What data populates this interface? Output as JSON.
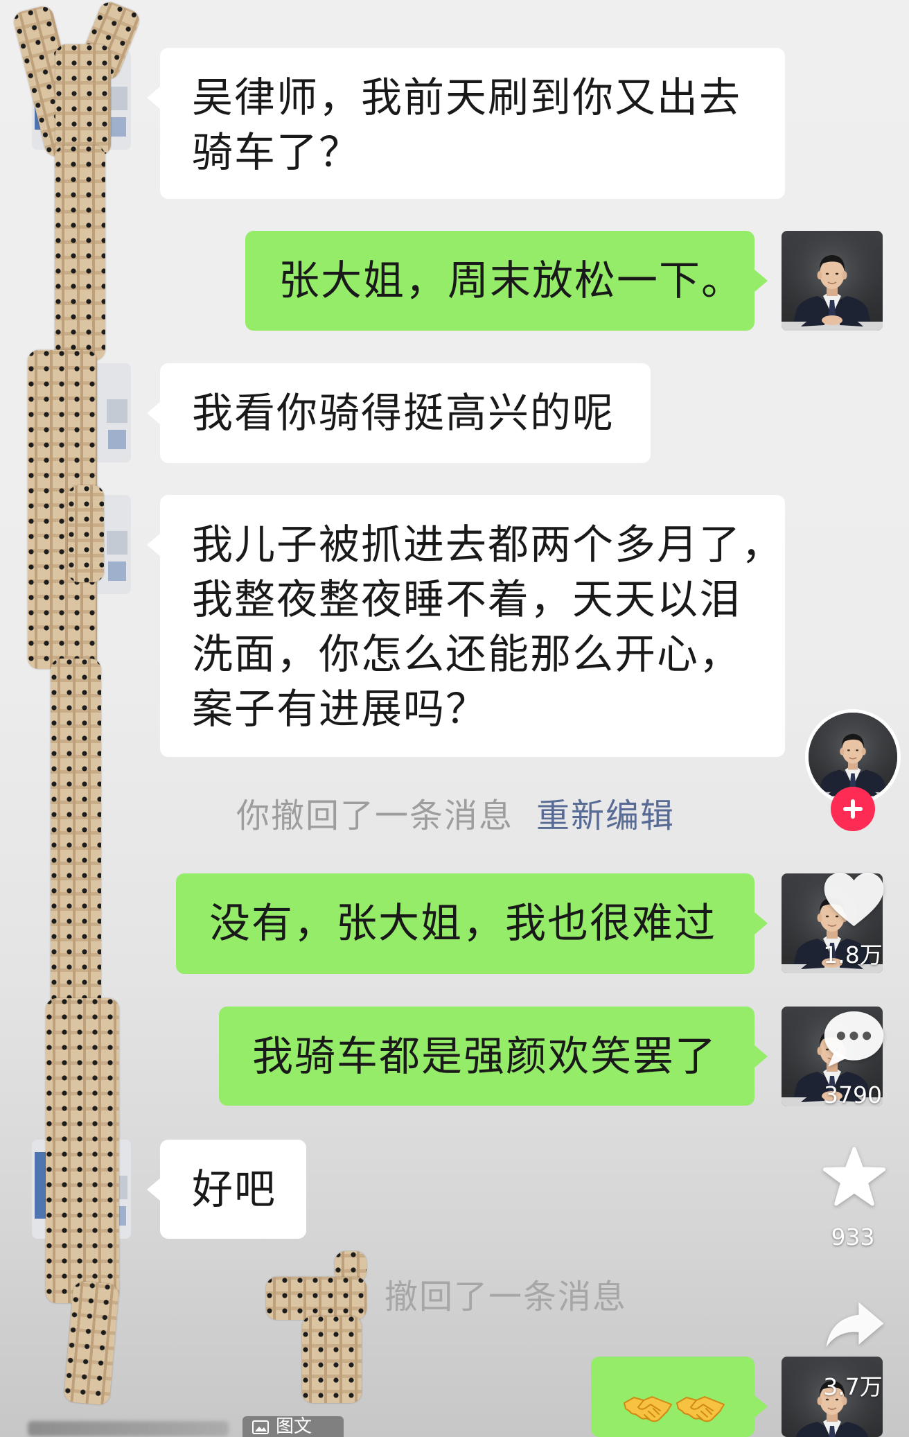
{
  "colors": {
    "outgoing_bubble": "#95ec69",
    "incoming_bubble": "#ffffff",
    "recall_link": "#576b95",
    "follow_badge": "#fe2c55"
  },
  "chat": {
    "messages": [
      {
        "lines": [
          "吴律师，我前天刷到你又出去",
          "骑车了？"
        ]
      },
      {
        "lines": [
          "张大姐，周末放松一下。"
        ]
      },
      {
        "lines": [
          "我看你骑得挺高兴的呢"
        ]
      },
      {
        "lines": [
          "我儿子被抓进去都两个多月了，",
          "我整夜整夜睡不着，天天以泪",
          "洗面，你怎么还能那么开心，",
          "案子有进展吗？"
        ]
      },
      {
        "system_text": "你撤回了一条消息",
        "system_action": "重新编辑"
      },
      {
        "lines": [
          "没有，张大姐，我也很难过"
        ]
      },
      {
        "lines": [
          "我骑车都是强颜欢笑罢了"
        ]
      },
      {
        "lines": [
          "好吧"
        ]
      },
      {
        "system_text": "撤回了一条消息"
      },
      {
        "icons": [
          "handshake-icon",
          "handshake-icon"
        ]
      }
    ]
  },
  "overlay": {
    "follow": {
      "icon": "plus-icon"
    },
    "like": {
      "icon": "heart-icon",
      "count": "1.8万"
    },
    "comment": {
      "icon": "comment-icon",
      "count": "3790"
    },
    "favorite": {
      "icon": "star-icon",
      "count": "933"
    },
    "share": {
      "icon": "share-icon",
      "count": "3.7万"
    }
  },
  "post": {
    "type_tag": "图文",
    "type_icon": "image-icon"
  }
}
